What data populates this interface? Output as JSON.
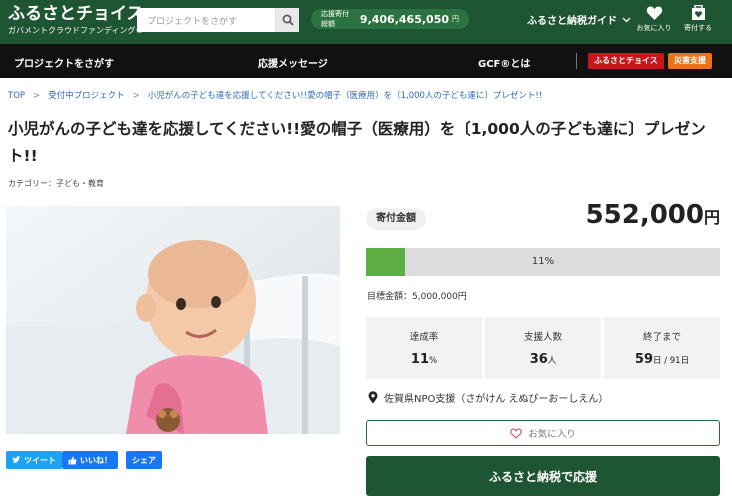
{
  "header": {
    "logo_main": "ふるさとチョイス",
    "logo_sub": "ガバメントクラウドファンディング®",
    "search_placeholder": "プロジェクトをさがす",
    "total_label": "応援寄付総額",
    "total_value": "9,406,465,050",
    "total_unit": "円",
    "guide_label": "ふるさと納税ガイド",
    "fav_label": "お気に入り",
    "donate_label": "寄付する"
  },
  "nav": {
    "items": [
      "プロジェクトをさがす",
      "応援メッセージ",
      "GCF®とは"
    ],
    "tag1": "ふるさとチョイス",
    "tag2": "災害支援",
    "tag1_color": "#c8161d",
    "tag2_color": "#e8731a"
  },
  "breadcrumb": {
    "top": "TOP",
    "level2": "受付中プロジェクト",
    "current": "小児がんの子ども達を応援してください!!愛の帽子（医療用）を〔1,000人の子ども達に〕プレゼント!!"
  },
  "project": {
    "title": "小児がんの子ども達を応援してください!!愛の帽子（医療用）を〔1,000人の子ども達に〕プレゼント!!",
    "category": "カテゴリー：子ども・教育"
  },
  "share": {
    "tweet": "ツイート",
    "like": "いいね！",
    "share": "シェア"
  },
  "donation": {
    "label": "寄付金額",
    "amount": "552,000",
    "unit": "円",
    "progress_percent": 11,
    "progress_text": "11%",
    "goal": "目標金額：5,000,000円",
    "stats": [
      {
        "key": "達成率",
        "value": "11",
        "unit": "%"
      },
      {
        "key": "支援人数",
        "value": "36",
        "unit": "人"
      },
      {
        "key": "終了まで",
        "value": "59",
        "unit": "日 / 91日"
      }
    ],
    "location": "佐賀県NPO支援（さがけん えぬぴーおーしえん）",
    "fav_button": "お気に入り",
    "donate_button": "ふるさと納税で応援"
  },
  "colors": {
    "brand_green": "#1e5532",
    "progress_green": "#5daf43",
    "twitter": "#1da1f2",
    "facebook": "#1877f2"
  }
}
